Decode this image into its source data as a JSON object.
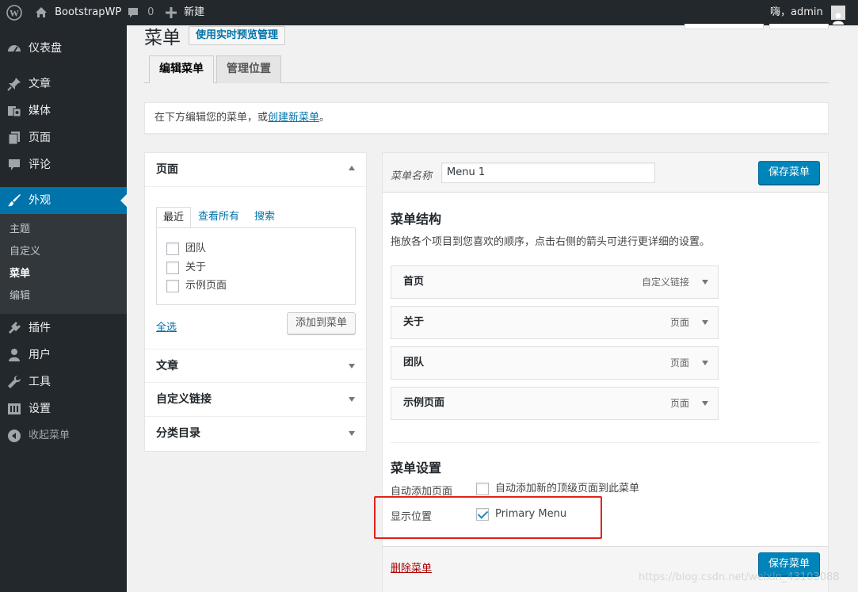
{
  "adminbar": {
    "site_name": "BootstrapWP",
    "comments_count": "0",
    "new_label": "新建",
    "greeting": "嗨，admin"
  },
  "sidebar": {
    "items": [
      {
        "label": "仪表盘",
        "icon": "dashboard-icon"
      },
      {
        "label": "文章",
        "icon": "pushpin-icon"
      },
      {
        "label": "媒体",
        "icon": "media-icon"
      },
      {
        "label": "页面",
        "icon": "page-icon"
      },
      {
        "label": "评论",
        "icon": "comment-icon"
      },
      {
        "label": "外观",
        "icon": "brush-icon"
      },
      {
        "label": "插件",
        "icon": "plugin-icon"
      },
      {
        "label": "用户",
        "icon": "user-icon"
      },
      {
        "label": "工具",
        "icon": "wrench-icon"
      },
      {
        "label": "设置",
        "icon": "settings-icon"
      },
      {
        "label": "收起菜单",
        "icon": "collapse-icon"
      }
    ],
    "submenu": [
      "主题",
      "自定义",
      "菜单",
      "编辑"
    ]
  },
  "page": {
    "title": "菜单",
    "title_action": "使用实时预览管理",
    "tabs": [
      "编辑菜单",
      "管理位置"
    ],
    "notice_prefix": "在下方编辑您的菜单，或",
    "notice_link": "创建新菜单",
    "notice_suffix": "。"
  },
  "left": {
    "pages_box": {
      "title": "页面",
      "tabs": [
        "最近",
        "查看所有",
        "搜索"
      ],
      "items": [
        "团队",
        "关于",
        "示例页面"
      ],
      "select_all": "全选",
      "add_button": "添加到菜单"
    },
    "boxes": [
      "文章",
      "自定义链接",
      "分类目录"
    ]
  },
  "editor": {
    "menu_name_label": "菜单名称",
    "menu_name_value": "Menu 1",
    "save_label": "保存菜单",
    "structure_title": "菜单结构",
    "structure_desc": "拖放各个项目到您喜欢的顺序，点击右侧的箭头可进行更详细的设置。",
    "items": [
      {
        "name": "首页",
        "type": "自定义链接"
      },
      {
        "name": "关于",
        "type": "页面"
      },
      {
        "name": "团队",
        "type": "页面"
      },
      {
        "name": "示例页面",
        "type": "页面"
      }
    ],
    "settings_title": "菜单设置",
    "auto_add_label": "自动添加页面",
    "auto_add_option": "自动添加新的顶级页面到此菜单",
    "location_label": "显示位置",
    "location_option": "Primary Menu",
    "location_checked": true,
    "delete_label": "删除菜单"
  },
  "watermark": "https://blog.csdn.net/weixin_43103088",
  "colors": {
    "accent": "#0073aa",
    "primary_button": "#0085ba",
    "highlight": "#e2231a",
    "delete": "#a00"
  }
}
